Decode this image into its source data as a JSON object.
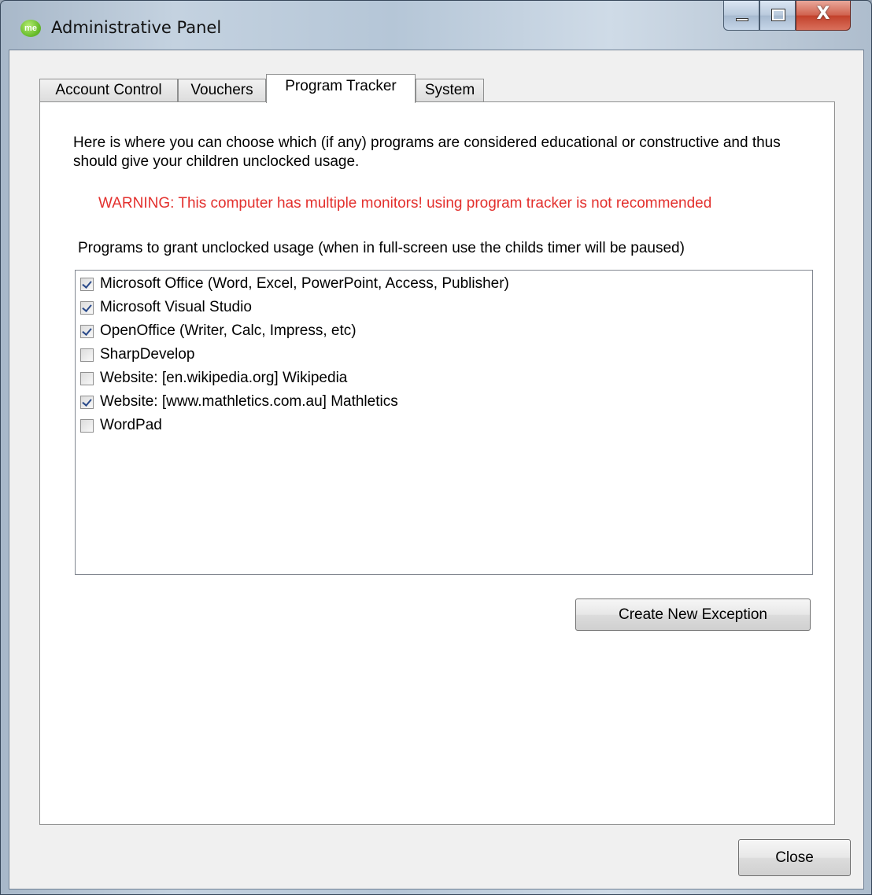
{
  "window": {
    "title": "Administrative Panel",
    "app_icon_text": "me",
    "close_glyph": "X"
  },
  "tabs": [
    {
      "label": "Account Control",
      "active": false
    },
    {
      "label": "Vouchers",
      "active": false
    },
    {
      "label": "Program Tracker",
      "active": true
    },
    {
      "label": "System",
      "active": false
    }
  ],
  "program_tracker": {
    "description": "Here is where you can choose which (if any) programs are considered educational or constructive and thus should give your children unclocked usage.",
    "warning": "WARNING: This computer has multiple monitors! using program tracker is not recommended",
    "list_label": "Programs to grant unclocked usage (when in full-screen use the childs timer will be paused)",
    "programs": [
      {
        "label": "Microsoft Office (Word, Excel, PowerPoint, Access, Publisher)",
        "checked": true
      },
      {
        "label": "Microsoft Visual Studio",
        "checked": true
      },
      {
        "label": "OpenOffice (Writer, Calc, Impress, etc)",
        "checked": true
      },
      {
        "label": "SharpDevelop",
        "checked": false
      },
      {
        "label": "Website: [en.wikipedia.org] Wikipedia",
        "checked": false
      },
      {
        "label": "Website: [www.mathletics.com.au] Mathletics",
        "checked": true
      },
      {
        "label": "WordPad",
        "checked": false
      }
    ],
    "create_button": "Create New Exception"
  },
  "footer": {
    "close_button": "Close"
  },
  "colors": {
    "warning": "#e3302d",
    "check": "#2a4a8a"
  }
}
